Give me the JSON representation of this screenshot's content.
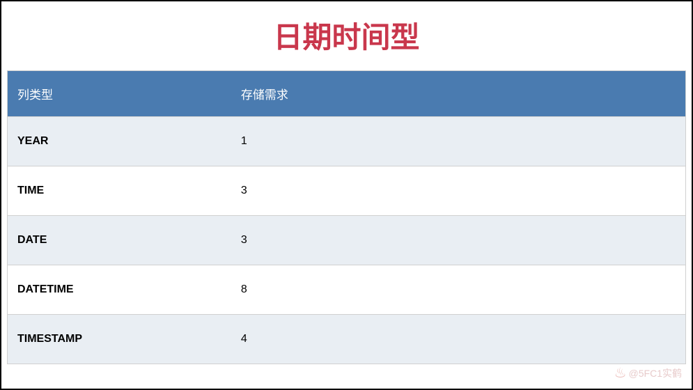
{
  "title": "日期时间型",
  "table": {
    "headers": [
      "列类型",
      "存储需求"
    ],
    "rows": [
      {
        "type": "YEAR",
        "storage": "1"
      },
      {
        "type": "TIME",
        "storage": "3"
      },
      {
        "type": "DATE",
        "storage": "3"
      },
      {
        "type": "DATETIME",
        "storage": "8"
      },
      {
        "type": "TIMESTAMP",
        "storage": "4"
      }
    ]
  },
  "watermark": "@5FC1实鹤"
}
